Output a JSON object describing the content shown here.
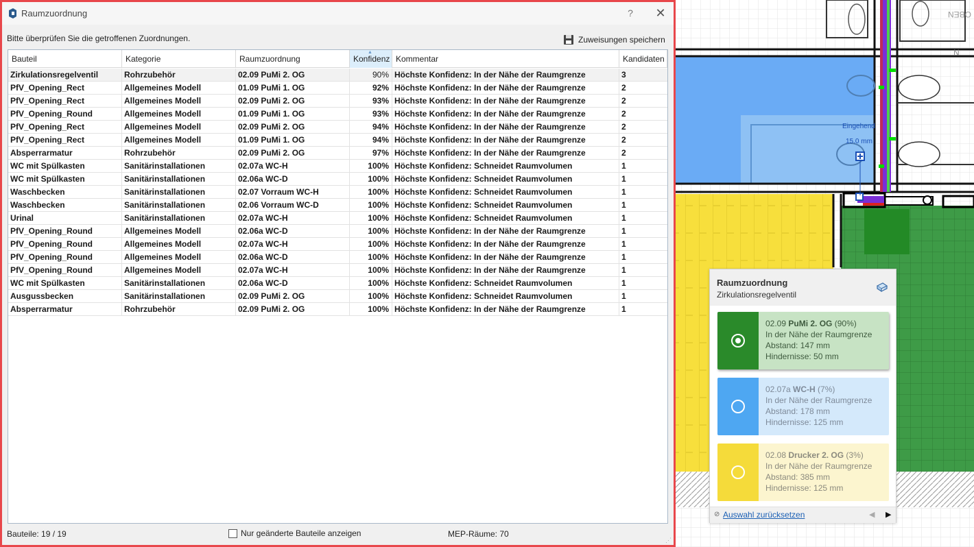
{
  "dialog": {
    "title": "Raumzuordnung",
    "help_label": "?",
    "close_label": "✕",
    "instruction": "Bitte überprüfen Sie die getroffenen Zuordnungen.",
    "save_label": "Zuweisungen speichern"
  },
  "table": {
    "columns": [
      "Bauteil",
      "Kategorie",
      "Raumzuordnung",
      "Konfidenz",
      "Kommentar",
      "Kandidaten"
    ],
    "sorted_column": "Konfidenz",
    "rows": [
      [
        "Zirkulationsregelventil",
        "Rohrzubehör",
        "02.09 PuMi 2. OG",
        "90%",
        "Höchste Konfidenz: In der Nähe der Raumgrenze",
        "3"
      ],
      [
        "PfV_Opening_Rect",
        "Allgemeines Modell",
        "01.09 PuMi 1. OG",
        "92%",
        "Höchste Konfidenz: In der Nähe der Raumgrenze",
        "2"
      ],
      [
        "PfV_Opening_Rect",
        "Allgemeines Modell",
        "02.09 PuMi 2. OG",
        "93%",
        "Höchste Konfidenz: In der Nähe der Raumgrenze",
        "2"
      ],
      [
        "PfV_Opening_Round",
        "Allgemeines Modell",
        "01.09 PuMi 1. OG",
        "93%",
        "Höchste Konfidenz: In der Nähe der Raumgrenze",
        "2"
      ],
      [
        "PfV_Opening_Rect",
        "Allgemeines Modell",
        "02.09 PuMi 2. OG",
        "94%",
        "Höchste Konfidenz: In der Nähe der Raumgrenze",
        "2"
      ],
      [
        "PfV_Opening_Rect",
        "Allgemeines Modell",
        "01.09 PuMi 1. OG",
        "94%",
        "Höchste Konfidenz: In der Nähe der Raumgrenze",
        "2"
      ],
      [
        "Absperrarmatur",
        "Rohrzubehör",
        "02.09 PuMi 2. OG",
        "97%",
        "Höchste Konfidenz: In der Nähe der Raumgrenze",
        "2"
      ],
      [
        "WC mit Spülkasten",
        "Sanitärinstallationen",
        "02.07a WC-H",
        "100%",
        "Höchste Konfidenz: Schneidet Raumvolumen",
        "1"
      ],
      [
        "WC mit Spülkasten",
        "Sanitärinstallationen",
        "02.06a WC-D",
        "100%",
        "Höchste Konfidenz: Schneidet Raumvolumen",
        "1"
      ],
      [
        "Waschbecken",
        "Sanitärinstallationen",
        "02.07 Vorraum WC-H",
        "100%",
        "Höchste Konfidenz: Schneidet Raumvolumen",
        "1"
      ],
      [
        "Waschbecken",
        "Sanitärinstallationen",
        "02.06 Vorraum WC-D",
        "100%",
        "Höchste Konfidenz: Schneidet Raumvolumen",
        "1"
      ],
      [
        "Urinal",
        "Sanitärinstallationen",
        "02.07a WC-H",
        "100%",
        "Höchste Konfidenz: Schneidet Raumvolumen",
        "1"
      ],
      [
        "PfV_Opening_Round",
        "Allgemeines Modell",
        "02.06a WC-D",
        "100%",
        "Höchste Konfidenz: In der Nähe der Raumgrenze",
        "1"
      ],
      [
        "PfV_Opening_Round",
        "Allgemeines Modell",
        "02.07a WC-H",
        "100%",
        "Höchste Konfidenz: In der Nähe der Raumgrenze",
        "1"
      ],
      [
        "PfV_Opening_Round",
        "Allgemeines Modell",
        "02.06a WC-D",
        "100%",
        "Höchste Konfidenz: In der Nähe der Raumgrenze",
        "1"
      ],
      [
        "PfV_Opening_Round",
        "Allgemeines Modell",
        "02.07a WC-H",
        "100%",
        "Höchste Konfidenz: In der Nähe der Raumgrenze",
        "1"
      ],
      [
        "WC mit Spülkasten",
        "Sanitärinstallationen",
        "02.06a WC-D",
        "100%",
        "Höchste Konfidenz: Schneidet Raumvolumen",
        "1"
      ],
      [
        "Ausgussbecken",
        "Sanitärinstallationen",
        "02.09 PuMi 2. OG",
        "100%",
        "Höchste Konfidenz: Schneidet Raumvolumen",
        "1"
      ],
      [
        "Absperrarmatur",
        "Rohrzubehör",
        "02.09 PuMi 2. OG",
        "100%",
        "Höchste Konfidenz: In der Nähe der Raumgrenze",
        "1"
      ]
    ]
  },
  "footer": {
    "count_label": "Bauteile: 19 / 19",
    "filter_label": "Nur geänderte Bauteile anzeigen",
    "filter_checked": false,
    "mep_label": "MEP-Räume: 70"
  },
  "panel": {
    "title": "Raumzuordnung",
    "subtitle": "Zirkulationsregelventil",
    "reset_label": "Auswahl zurücksetzen",
    "candidates": [
      {
        "code": "02.09",
        "name": "PuMi 2. OG",
        "pct": "(90%)",
        "reason": "In der Nähe der Raumgrenze",
        "distance": "Abstand: 147 mm",
        "obstacles": "Hindernisse: 50 mm",
        "selected": true,
        "swatch": "#2a8a2a",
        "bg": "#c7e3c4"
      },
      {
        "code": "02.07a",
        "name": "WC-H",
        "pct": "(7%)",
        "reason": "In der Nähe der Raumgrenze",
        "distance": "Abstand: 178 mm",
        "obstacles": "Hindernisse: 125 mm",
        "selected": false,
        "swatch": "#4ea7f2",
        "bg": "#d4e9fb"
      },
      {
        "code": "02.08",
        "name": "Drucker 2. OG",
        "pct": "(3%)",
        "reason": "In der Nähe der Raumgrenze",
        "distance": "Abstand: 385 mm",
        "obstacles": "Hindernisse: 125 mm",
        "selected": false,
        "swatch": "#f5db3a",
        "bg": "#fcf5cf"
      }
    ]
  },
  "plan": {
    "label_eingehend": "Eingehend",
    "label_dimension": "15.0 mm",
    "label_oben": "OBEN",
    "label_n": "N",
    "room_colors": {
      "blue": "#6aabf5",
      "yellow": "#f7df3c",
      "green": "#3e9b47",
      "dark_green": "#238a26"
    }
  }
}
